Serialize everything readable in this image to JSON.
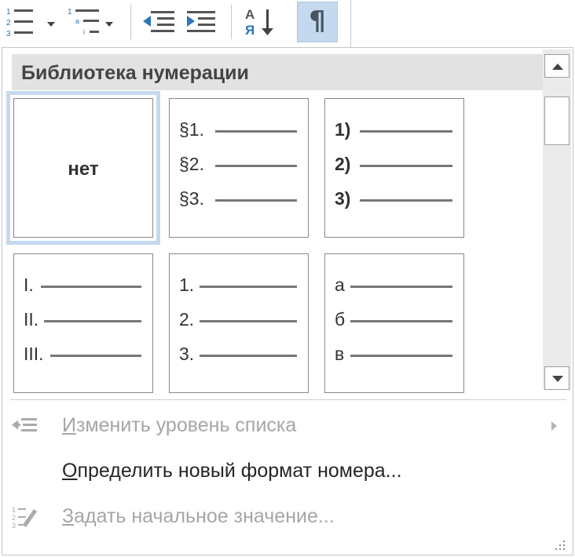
{
  "toolbar": {
    "numbering_button": "numbering-list",
    "multilevel_button": "multilevel-list",
    "decrease_indent": "decrease-indent",
    "increase_indent": "increase-indent",
    "sort_glyph_top": "А",
    "sort_glyph_bottom": "Я",
    "pilcrow": "¶"
  },
  "library": {
    "header": "Библиотека нумерации",
    "none_label": "нет",
    "tiles": [
      {
        "markers": [
          "§1.",
          "§2.",
          "§3."
        ],
        "bold": false
      },
      {
        "markers": [
          "1)",
          "2)",
          "3)"
        ],
        "bold": true
      },
      {
        "markers": [
          "I.",
          "II.",
          "III."
        ],
        "bold": false
      },
      {
        "markers": [
          "1.",
          "2.",
          "3."
        ],
        "bold": false
      },
      {
        "markers": [
          "а",
          "б",
          "в"
        ],
        "bold": false
      }
    ]
  },
  "menu": {
    "change_level_prefix": "И",
    "change_level_rest": "зменить уровень списка",
    "define_format_prefix": "О",
    "define_format_rest": "пределить новый формат номера...",
    "set_value_prefix": "З",
    "set_value_rest": "адать начальное значение..."
  },
  "colors": {
    "selection": "#c5d9ee",
    "header_bg": "#e2e2e2",
    "disabled_text": "#a6a6a6"
  }
}
